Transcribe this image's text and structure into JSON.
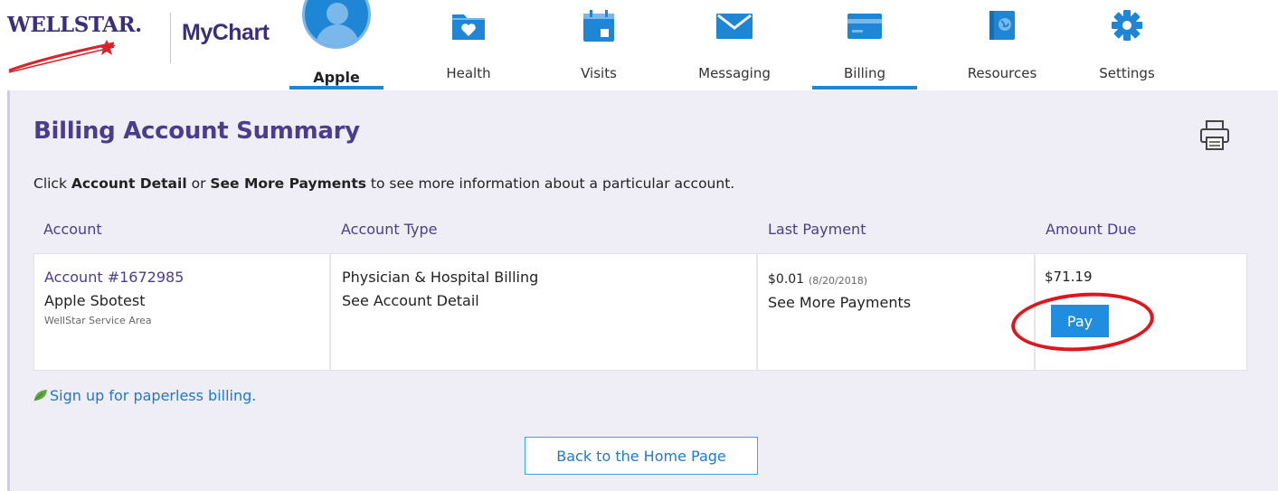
{
  "brand": {
    "wellstar": "WELLSTAR.",
    "mychart": "MyChart"
  },
  "nav": {
    "items": [
      {
        "label": "Apple",
        "icon": "user-avatar-icon",
        "active": true
      },
      {
        "label": "Health",
        "icon": "folder-heart-icon"
      },
      {
        "label": "Visits",
        "icon": "calendar-icon"
      },
      {
        "label": "Messaging",
        "icon": "envelope-icon"
      },
      {
        "label": "Billing",
        "icon": "credit-card-icon",
        "active": true
      },
      {
        "label": "Resources",
        "icon": "book-globe-icon"
      },
      {
        "label": "Settings",
        "icon": "gear-icon"
      }
    ]
  },
  "page": {
    "title": "Billing Account Summary",
    "instructions_prefix": "Click ",
    "instructions_bold1": "Account Detail",
    "instructions_mid": " or ",
    "instructions_bold2": "See More Payments",
    "instructions_suffix": " to see more information about a particular account."
  },
  "table": {
    "headers": [
      "Account",
      "Account Type",
      "Last Payment",
      "Amount Due"
    ],
    "row": {
      "account_number": "Account #1672985",
      "patient_name": "Apple Sbotest",
      "service_area": "WellStar Service Area",
      "account_type": "Physician & Hospital Billing",
      "detail_link": "See Account Detail",
      "last_payment_amount": "$0.01",
      "last_payment_date": "(8/20/2018)",
      "more_payments_link": "See More Payments",
      "amount_due": "$71.19",
      "pay_label": "Pay"
    }
  },
  "paperless_link": "Sign up for paperless billing.",
  "back_button": "Back to the Home Page",
  "colors": {
    "brand_purple": "#4b3c8e",
    "link_blue": "#1f78c8",
    "accent_blue": "#1f86d6",
    "highlight_red": "#e0161d",
    "leaf_green": "#5aa83a"
  }
}
